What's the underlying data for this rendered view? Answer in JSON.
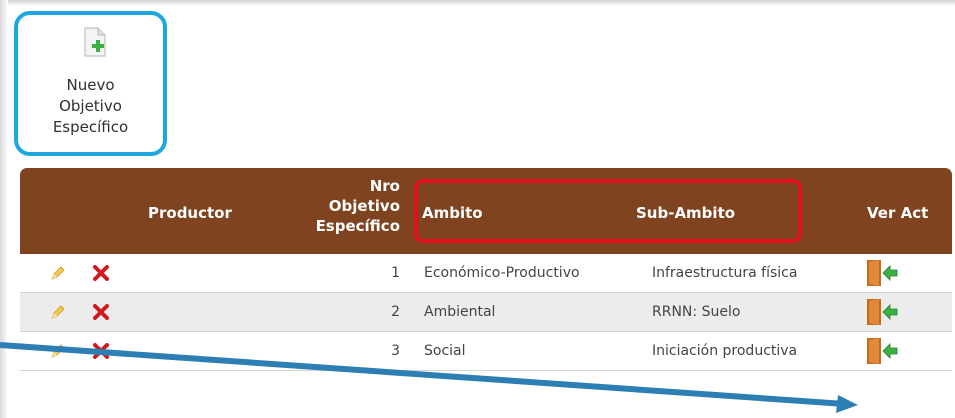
{
  "toolbar": {
    "new_button_label_1": "Nuevo",
    "new_button_label_2": "Objetivo",
    "new_button_label_3": "Específico"
  },
  "table": {
    "headers": {
      "productor": "Productor",
      "nro_1": "Nro",
      "nro_2": "Objetivo",
      "nro_3": "Específico",
      "ambito": "Ambito",
      "sub_ambito": "Sub-Ambito",
      "ver_act": "Ver Act"
    },
    "rows": [
      {
        "nro": "1",
        "ambito": "Económico-Productivo",
        "sub_ambito": "Infraestructura física"
      },
      {
        "nro": "2",
        "ambito": "Ambiental",
        "sub_ambito": "RRNN: Suelo"
      },
      {
        "nro": "3",
        "ambito": "Social",
        "sub_ambito": "Iniciación productiva"
      }
    ]
  },
  "colors": {
    "header_bg": "#7f4320",
    "highlight_blue": "#1ea7dd",
    "highlight_red": "#e0121a",
    "arrow": "#2d7fb3"
  },
  "icons": {
    "new": "new-document-icon",
    "edit": "pencil-icon",
    "delete": "delete-x-icon",
    "view": "door-exit-icon"
  }
}
